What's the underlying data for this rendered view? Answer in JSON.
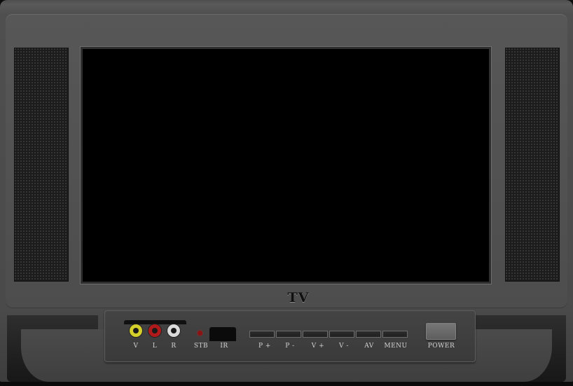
{
  "brand": "TV",
  "jack_labels": {
    "video": "V",
    "left": "L",
    "right": "R"
  },
  "indicator_labels": {
    "standby": "STB",
    "infrared": "IR"
  },
  "buttons": [
    {
      "id": "program-up",
      "label": "P +"
    },
    {
      "id": "program-down",
      "label": "P -"
    },
    {
      "id": "volume-up",
      "label": "V +"
    },
    {
      "id": "volume-down",
      "label": "V -"
    },
    {
      "id": "av",
      "label": "AV"
    },
    {
      "id": "menu",
      "label": "MENU"
    }
  ],
  "power_label": "POWER",
  "colors": {
    "video_jack": "#d4cf2a",
    "audio_left_jack": "#b01a1a",
    "audio_right_jack": "#dadada",
    "standby_led": "#8a1313",
    "screen": "#000000"
  }
}
